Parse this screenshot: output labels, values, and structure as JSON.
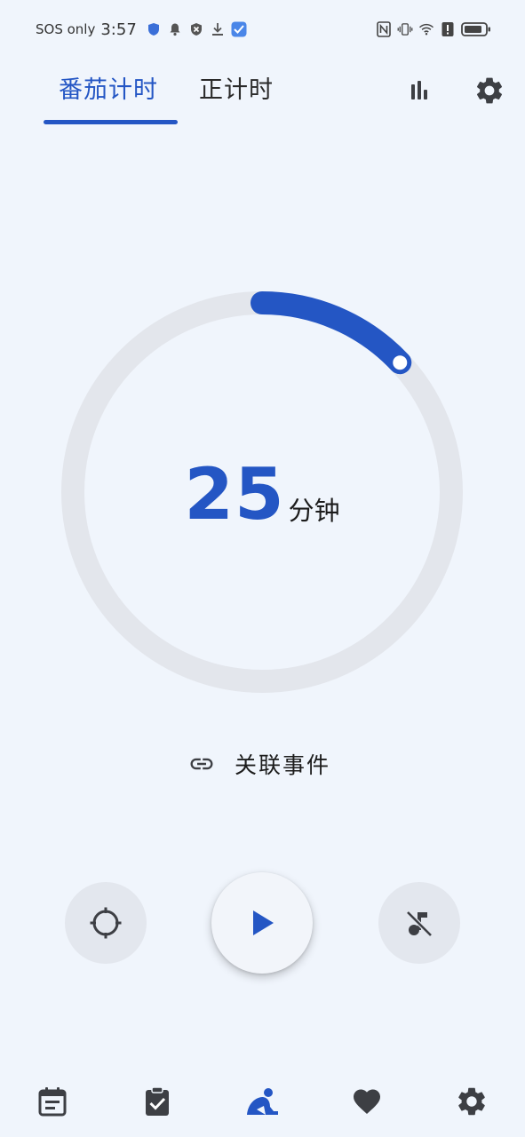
{
  "status_bar": {
    "carrier": "SOS only",
    "time": "3:57"
  },
  "tabs": [
    {
      "label": "番茄计时",
      "active": true
    },
    {
      "label": "正计时",
      "active": false
    }
  ],
  "timer": {
    "minutes": "25",
    "unit": "分钟",
    "progress_fraction": 0.13
  },
  "link_event": {
    "label": "关联事件"
  },
  "controls": {
    "focus": "crosshair-icon",
    "play": "play-icon",
    "music": "music-off-icon"
  },
  "bottom_nav": [
    {
      "icon": "calendar-icon",
      "active": false
    },
    {
      "icon": "checklist-icon",
      "active": false
    },
    {
      "icon": "meditation-icon",
      "active": true
    },
    {
      "icon": "heart-icon",
      "active": false
    },
    {
      "icon": "gear-icon",
      "active": false
    }
  ],
  "colors": {
    "accent": "#2456c4",
    "background": "#f0f5fc",
    "ring_track": "#e3e6ec",
    "icon_dark": "#3d3f44"
  }
}
